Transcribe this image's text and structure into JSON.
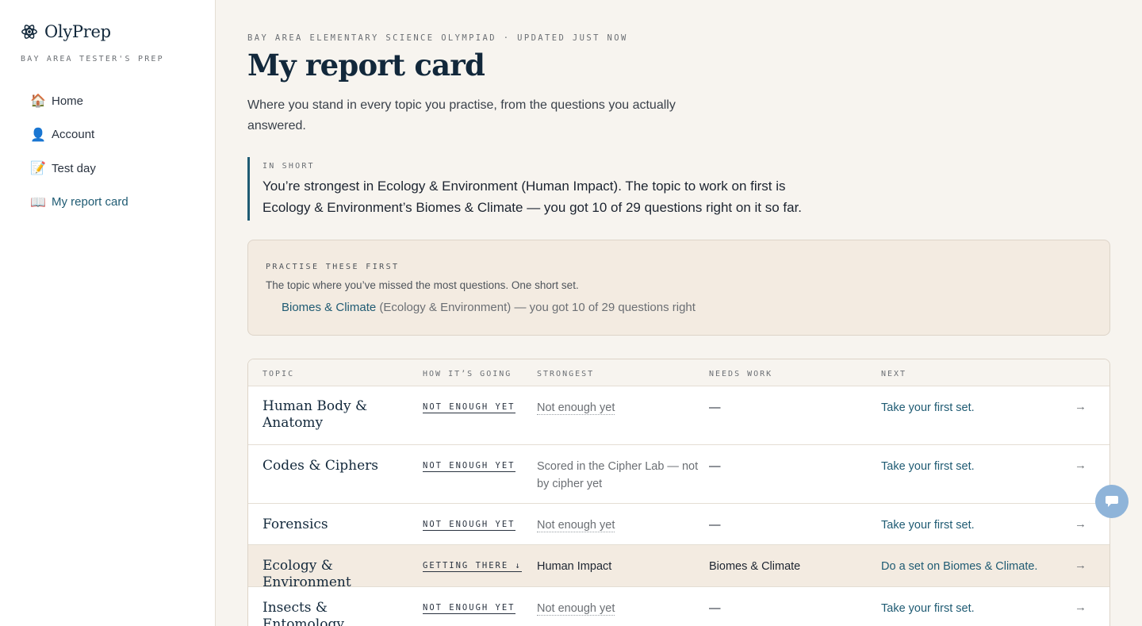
{
  "sidebar": {
    "brand_name": "OlyPrep",
    "brand_sub": "BAY AREA TESTER'S PREP",
    "items": [
      {
        "label": "Home",
        "icon": "🏠"
      },
      {
        "label": "Account",
        "icon": "👤"
      },
      {
        "label": "Test day",
        "icon": "📝"
      },
      {
        "label": "My report card",
        "icon": "📖"
      }
    ]
  },
  "header": {
    "eyebrow": "BAY AREA ELEMENTARY SCIENCE OLYMPIAD · UPDATED JUST NOW",
    "title": "My report card",
    "intro": "Where you stand in every topic you practise, from the questions you actually answered."
  },
  "summary": {
    "label": "IN SHORT",
    "text": "You’re strongest in Ecology & Environment (Human Impact). The topic to work on first is Ecology & Environment’s Biomes & Climate — you got 10 of 29 questions right on it so far."
  },
  "focus": {
    "label": "PRACTISE THESE FIRST",
    "sub": "The topic where you’ve missed the most questions. One short set.",
    "item_link": "Biomes & Climate",
    "item_rest": " (Ecology & Environment) — you got 10 of 29 questions right"
  },
  "table": {
    "headers": [
      "TOPIC",
      "HOW IT’S GOING",
      "STRONGEST",
      "NEEDS WORK",
      "NEXT"
    ],
    "rows": [
      {
        "topic": "Human Body & Anatomy",
        "status": "NOT ENOUGH YET",
        "strongest": "Not enough yet",
        "needs": "—",
        "next": "Take your first set."
      },
      {
        "topic": "Codes & Ciphers",
        "status": "NOT ENOUGH YET",
        "strongest": "Scored in the Cipher Lab — not by cipher yet",
        "needs": "—",
        "next": "Take your first set."
      },
      {
        "topic": "Forensics",
        "status": "NOT ENOUGH YET",
        "strongest": "Not enough yet",
        "needs": "—",
        "next": "Take your first set."
      },
      {
        "topic": "Ecology & Environment",
        "status": "GETTING THERE ↓",
        "strongest": "Human Impact",
        "needs": "Biomes & Climate",
        "next": "Do a set on Biomes & Climate."
      },
      {
        "topic": "Insects & Entomology",
        "status": "NOT ENOUGH YET",
        "strongest": "Not enough yet",
        "needs": "—",
        "next": "Take your first set."
      }
    ],
    "arrow": "→"
  },
  "colors": {
    "accent": "#1f5b73",
    "background": "#f7f4ef",
    "highlight": "#f3ebe1",
    "chat": "#8fb4d9"
  }
}
